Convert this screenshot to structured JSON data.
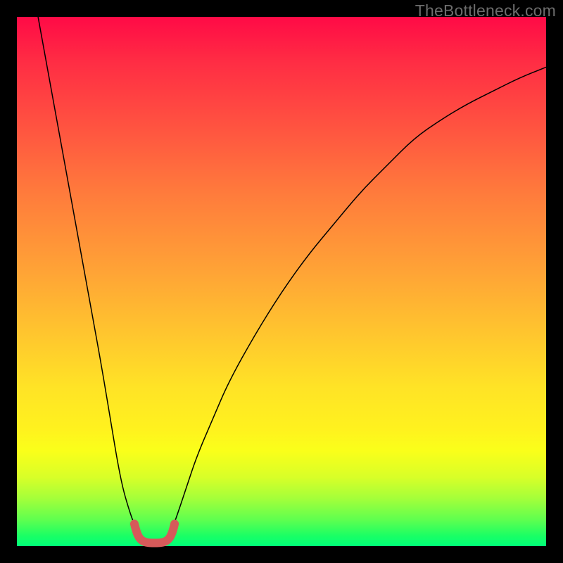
{
  "watermark": "TheBottleneck.com",
  "chart_data": {
    "type": "line",
    "title": "",
    "xlabel": "",
    "ylabel": "",
    "xlim": [
      0,
      100
    ],
    "ylim": [
      0,
      100
    ],
    "grid": false,
    "legend": false,
    "annotations": [
      {
        "text": "TheBottleneck.com",
        "position": "top-right",
        "color": "#6c6c6c"
      }
    ],
    "series": [
      {
        "name": "curve-left",
        "color": "#000000",
        "width": 1.5,
        "x": [
          4,
          6,
          8,
          10,
          12,
          14,
          16,
          18,
          19,
          20,
          21,
          22,
          23,
          23.5
        ],
        "y": [
          100,
          89,
          78,
          67,
          56,
          45,
          34,
          22,
          16,
          11,
          7.5,
          4.5,
          2.5,
          1.5
        ]
      },
      {
        "name": "curve-right",
        "color": "#000000",
        "width": 1.5,
        "x": [
          28.5,
          29,
          30,
          32,
          34,
          37,
          40,
          45,
          50,
          55,
          60,
          65,
          70,
          75,
          80,
          85,
          90,
          95,
          100
        ],
        "y": [
          1.5,
          2.5,
          5,
          11,
          17,
          24,
          31,
          40,
          48,
          55,
          61,
          67,
          72,
          77,
          80.5,
          83.5,
          86,
          88.5,
          90.5
        ]
      },
      {
        "name": "highlight-band",
        "color": "#d65a5a",
        "width": 12,
        "x": [
          22.2,
          22.6,
          23.2,
          24.0,
          25.0,
          26.0,
          27.0,
          28.0,
          28.8,
          29.4,
          29.8
        ],
        "y": [
          4.2,
          2.6,
          1.4,
          0.8,
          0.6,
          0.6,
          0.6,
          0.8,
          1.4,
          2.6,
          4.2
        ]
      }
    ]
  }
}
